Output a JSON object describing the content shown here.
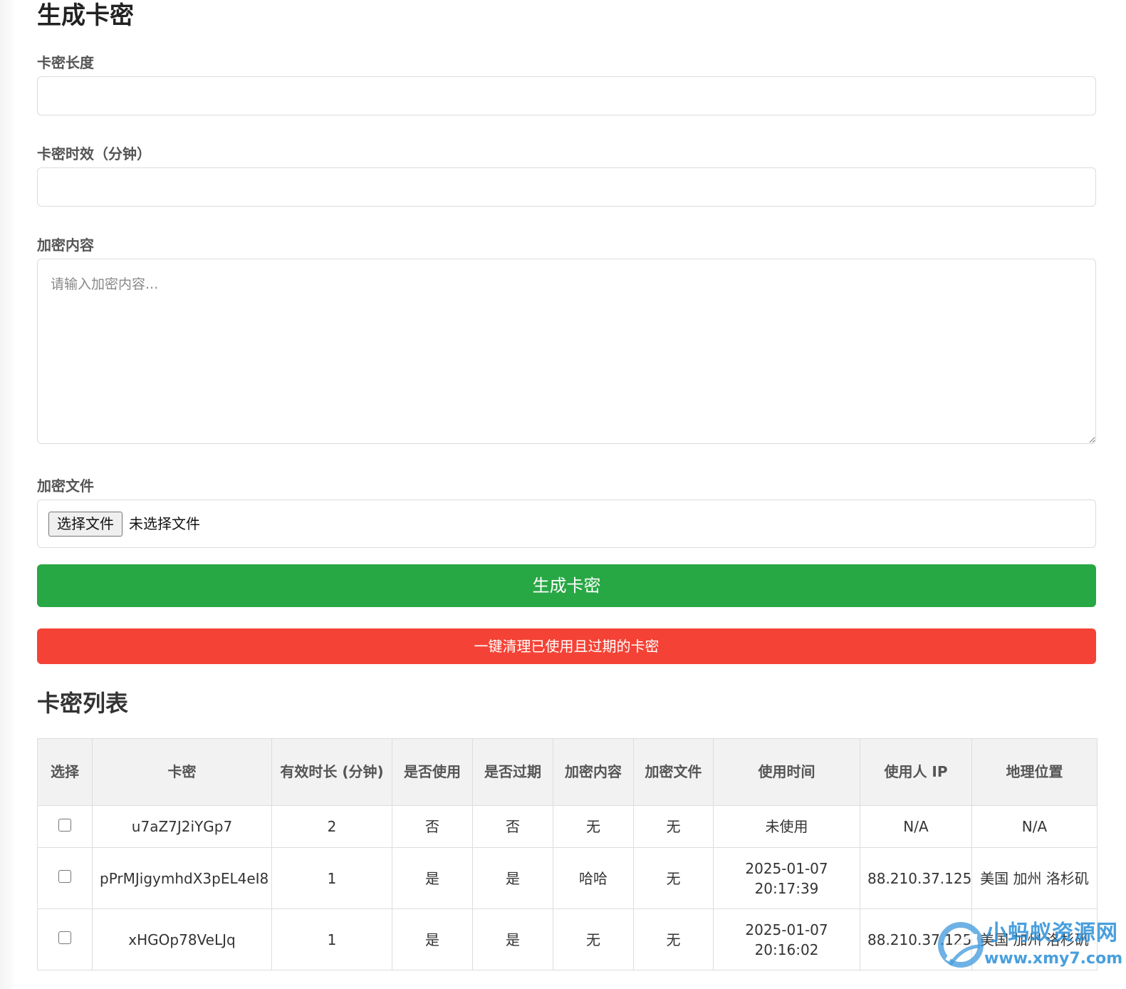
{
  "page": {
    "title": "生成卡密"
  },
  "form": {
    "length_label": "卡密长度",
    "length_value": "",
    "duration_label": "卡密时效（分钟）",
    "duration_value": "",
    "content_label": "加密内容",
    "content_placeholder": "请输入加密内容...",
    "file_label": "加密文件",
    "file_button_label": "选择文件",
    "file_status": "未选择文件"
  },
  "actions": {
    "generate_label": "生成卡密",
    "clean_label": "一键清理已使用且过期的卡密",
    "generate_color": "#28a745",
    "clean_color": "#f44336"
  },
  "list": {
    "title": "卡密列表",
    "headers": [
      "选择",
      "卡密",
      "有效时长 (分钟)",
      "是否使用",
      "是否过期",
      "加密内容",
      "加密文件",
      "使用时间",
      "使用人 IP",
      "地理位置"
    ],
    "rows": [
      {
        "checked": false,
        "code": "u7aZ7J2iYGp7",
        "duration": "2",
        "used": "否",
        "expired": "否",
        "content": "无",
        "file": "无",
        "use_time": "未使用",
        "ip": "N/A",
        "location": "N/A"
      },
      {
        "checked": false,
        "code": "pPrMJigymhdX3pEL4eI8",
        "duration": "1",
        "used": "是",
        "expired": "是",
        "content": "哈哈",
        "file": "无",
        "use_time": "2025-01-07 20:17:39",
        "ip": "88.210.37.125",
        "location": "美国 加州 洛杉矶"
      },
      {
        "checked": false,
        "code": "xHGOp78VeLJq",
        "duration": "1",
        "used": "是",
        "expired": "是",
        "content": "无",
        "file": "无",
        "use_time": "2025-01-07 20:16:02",
        "ip": "88.210.37.125",
        "location": "美国 加州 洛杉矶"
      }
    ]
  },
  "watermark": {
    "name": "小蚂蚁资源网",
    "url": "www.xmy7.com"
  }
}
